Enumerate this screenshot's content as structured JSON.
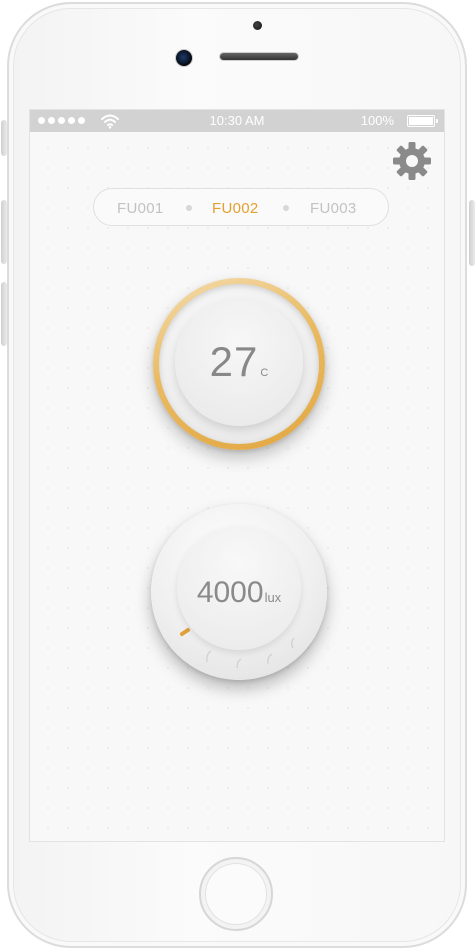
{
  "status_bar": {
    "time": "10:30 AM",
    "battery_percent": "100%"
  },
  "header": {
    "settings_icon": "gear-icon"
  },
  "device_tabs": [
    {
      "label": "FU001",
      "active": false
    },
    {
      "label": "FU002",
      "active": true
    },
    {
      "label": "FU003",
      "active": false
    }
  ],
  "temperature": {
    "value": "27",
    "unit": "C"
  },
  "light": {
    "value": "4000",
    "unit": "lux"
  },
  "colors": {
    "accent": "#e3a02f",
    "tab_inactive": "#c2c2c2",
    "status_bar": "#d2d2d2",
    "readout_text": "#888888"
  }
}
